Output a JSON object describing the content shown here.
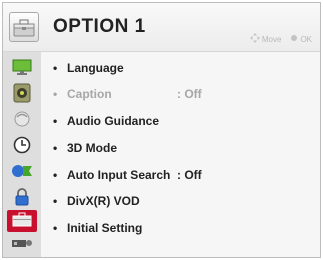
{
  "header": {
    "title": "OPTION 1",
    "hint_move": "Move",
    "hint_ok": "OK"
  },
  "sidebar": {
    "items": [
      {
        "icon": "picture-icon"
      },
      {
        "icon": "sound-icon"
      },
      {
        "icon": "channel-icon"
      },
      {
        "icon": "time-icon"
      },
      {
        "icon": "network-icon"
      },
      {
        "icon": "lock-icon"
      },
      {
        "icon": "option1-icon",
        "selected": true
      },
      {
        "icon": "option2-icon"
      }
    ]
  },
  "menu": {
    "items": [
      {
        "label": "Language",
        "value": "",
        "disabled": false
      },
      {
        "label": "Caption",
        "value": ": Off",
        "disabled": true
      },
      {
        "label": "Audio Guidance",
        "value": "",
        "disabled": false
      },
      {
        "label": "3D Mode",
        "value": "",
        "disabled": false
      },
      {
        "label": "Auto Input Search",
        "value": ": Off",
        "disabled": false
      },
      {
        "label": "DivX(R) VOD",
        "value": "",
        "disabled": false
      },
      {
        "label": "Initial Setting",
        "value": "",
        "disabled": false
      }
    ]
  },
  "colors": {
    "accent": "#c8102e",
    "disabled_text": "#a7a7a7"
  }
}
